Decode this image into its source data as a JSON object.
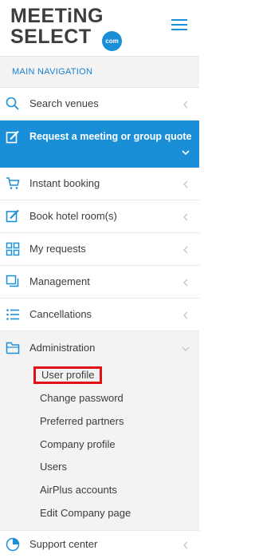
{
  "brand": {
    "line1": "MEETiNG",
    "line2": "SELECT",
    "badge": "com",
    "accent": "#1a8fd8"
  },
  "nav": {
    "section_label": "MAIN NAVIGATION",
    "items": [
      {
        "label": "Search venues",
        "icon": "search-icon"
      },
      {
        "label": "Request a meeting or group quote",
        "icon": "edit-icon"
      },
      {
        "label": "Instant booking",
        "icon": "cart-icon"
      },
      {
        "label": "Book hotel room(s)",
        "icon": "edit-icon"
      },
      {
        "label": "My requests",
        "icon": "grid-icon"
      },
      {
        "label": "Management",
        "icon": "copy-icon"
      },
      {
        "label": "Cancellations",
        "icon": "list-icon"
      },
      {
        "label": "Administration",
        "icon": "folder-icon"
      },
      {
        "label": "Support center",
        "icon": "lifebuoy-icon"
      }
    ],
    "admin_subitems": [
      "User profile",
      "Change password",
      "Preferred partners",
      "Company profile",
      "Users",
      "AirPlus accounts",
      "Edit Company page"
    ]
  },
  "colors": {
    "active_bg": "#1a8fd8",
    "highlight_border": "#e01218",
    "section_text": "#1a7fcf"
  }
}
